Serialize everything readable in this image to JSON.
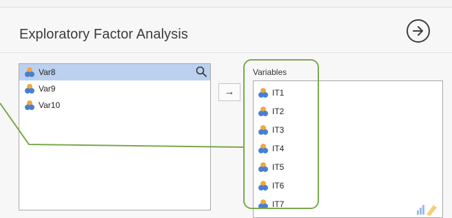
{
  "title": "Exploratory Factor Analysis",
  "run_icon": "arrow-right-circle-icon",
  "source_list": {
    "items": [
      {
        "label": "Var8",
        "selected": true
      },
      {
        "label": "Var9",
        "selected": false
      },
      {
        "label": "Var10",
        "selected": false
      }
    ]
  },
  "move_button": {
    "label": "→"
  },
  "variables_box": {
    "label": "Variables",
    "items": [
      {
        "label": "IT1"
      },
      {
        "label": "IT2"
      },
      {
        "label": "IT3"
      },
      {
        "label": "IT4"
      },
      {
        "label": "IT5"
      },
      {
        "label": "IT6"
      },
      {
        "label": "IT7"
      }
    ]
  },
  "colors": {
    "highlight": "#79a84a",
    "selected_row": "#bcd1ef",
    "variable_icon_orange": "#f0a93a",
    "variable_icon_blue": "#4a7fd0"
  }
}
